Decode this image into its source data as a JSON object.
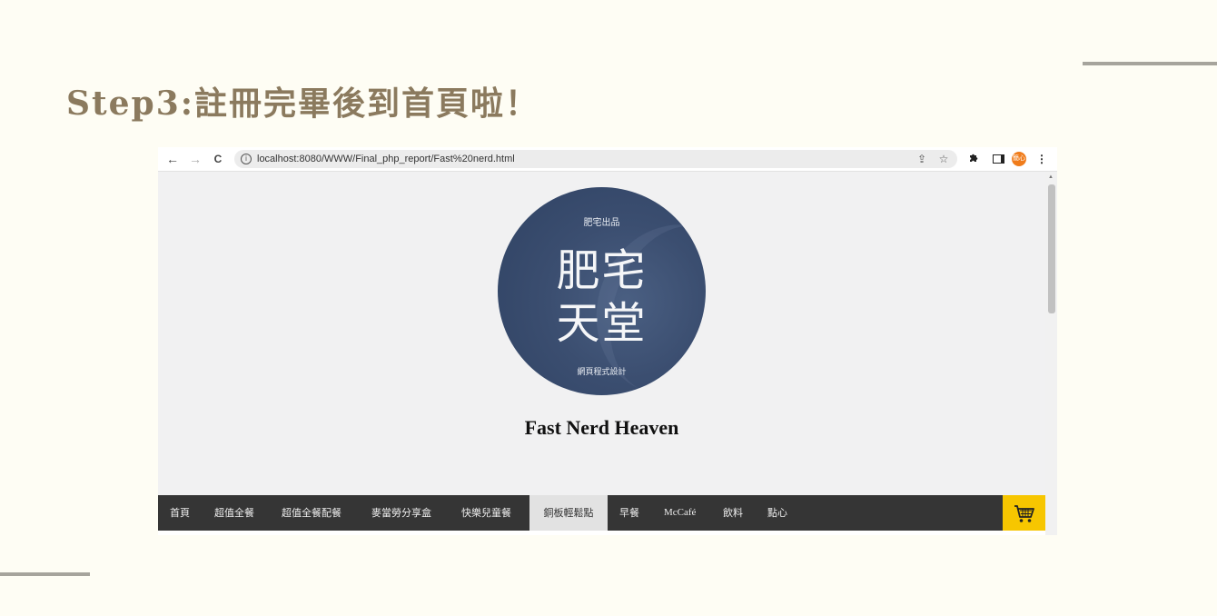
{
  "slide": {
    "title": "Step3:註冊完畢後到首頁啦！"
  },
  "browser": {
    "nav": {
      "back": "←",
      "forward": "→",
      "reload": "C"
    },
    "url": "localhost:8080/WWW/Final_php_report/Fast%20nerd.html",
    "avatar_text": "簡心",
    "menu_glyph": "⋮"
  },
  "site": {
    "logo": {
      "top_text": "肥宅出品",
      "line1": "肥宅",
      "line2": "天堂",
      "bottom_text": "網頁程式設計"
    },
    "title": "Fast Nerd Heaven",
    "nav_items": [
      {
        "label": "首頁"
      },
      {
        "label": "超值全餐"
      },
      {
        "label": "超值全餐配餐"
      },
      {
        "label": "麥當勞分享盒"
      },
      {
        "label": "快樂兒童餐"
      },
      {
        "label": "銅板輕鬆點"
      },
      {
        "label": "早餐"
      },
      {
        "label": "McCafé"
      },
      {
        "label": "飲料"
      },
      {
        "label": "點心"
      }
    ],
    "active_nav": "銅板輕鬆點",
    "colors": {
      "navbar_bg": "#353535",
      "cart_bg": "#f7c600",
      "logo_bg": "#3b4e70",
      "title_accent": "#8b7a5e"
    }
  }
}
